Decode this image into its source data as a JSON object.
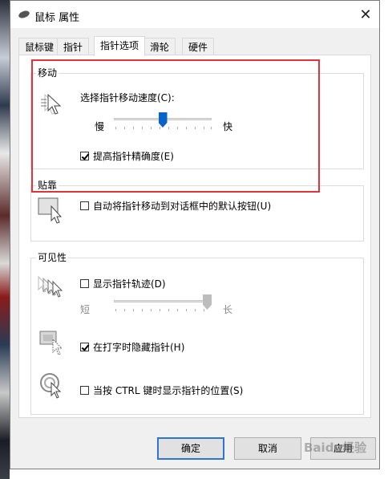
{
  "window": {
    "title": "鼠标 属性"
  },
  "tabs": [
    "鼠标键",
    "指针",
    "指针选项",
    "滑轮",
    "硬件"
  ],
  "active_tab": "指针选项",
  "motion": {
    "label": "移动",
    "speed_label": "选择指针移动速度(C):",
    "slow": "慢",
    "fast": "快",
    "speed_level": 0.5,
    "precision_label": "提高指针精确度(E)",
    "precision_checked": true
  },
  "snap": {
    "label": "贴靠",
    "snap_label": "自动将指针移动到对话框中的默认按钮(U)",
    "snap_checked": false
  },
  "visibility": {
    "label": "可见性",
    "trails_label": "显示指针轨迹(D)",
    "trails_checked": false,
    "short": "短",
    "long": "长",
    "trail_level": 1.0,
    "hide_label": "在打字时隐藏指针(H)",
    "hide_checked": true,
    "ctrl_label": "当按 CTRL 键时显示指针的位置(S)",
    "ctrl_checked": false
  },
  "buttons": {
    "ok": "确定",
    "cancel": "取消",
    "apply": "应用"
  },
  "watermark": "Baidu经验",
  "colors": {
    "highlight_box": "#e0343a",
    "slider_thumb": "#0a63c9",
    "primary_border": "#2f74d0"
  }
}
